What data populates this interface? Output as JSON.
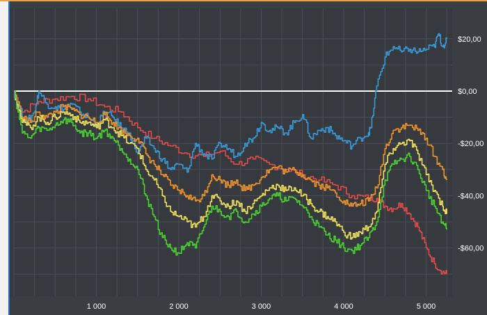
{
  "chart_data": {
    "type": "line",
    "title": "",
    "xlabel": "",
    "ylabel": "",
    "xlim": [
      0,
      5300
    ],
    "ylim": [
      -80,
      28
    ],
    "x_ticks": [
      {
        "value": 1000,
        "label": "1 000"
      },
      {
        "value": 2000,
        "label": "2 000"
      },
      {
        "value": 3000,
        "label": "3 000"
      },
      {
        "value": 4000,
        "label": "4 000"
      },
      {
        "value": 5000,
        "label": "5 000"
      }
    ],
    "y_ticks": [
      {
        "value": 20,
        "label": "$20,00"
      },
      {
        "value": 0,
        "label": "$0,00"
      },
      {
        "value": -20,
        "label": "-$20,00"
      },
      {
        "value": -40,
        "label": "-$40,00"
      },
      {
        "value": -60,
        "label": "-$60,00"
      }
    ],
    "grid": true,
    "zero_line": {
      "value": 0,
      "color": "#ffffff"
    },
    "series": [
      {
        "color": "#e24c4c",
        "x": [
          0,
          100,
          300,
          500,
          700,
          900,
          1100,
          1300,
          1500,
          1700,
          1900,
          2100,
          2300,
          2500,
          2700,
          2900,
          3100,
          3300,
          3500,
          3700,
          3900,
          4100,
          4300,
          4400,
          4500,
          4600,
          4700,
          4800,
          4900,
          5000,
          5100,
          5200,
          5250
        ],
        "values": [
          0,
          -8,
          -4,
          -3,
          -2,
          -3,
          -6,
          -8,
          -14,
          -18,
          -21,
          -24,
          -25,
          -23,
          -28,
          -26,
          -28,
          -30,
          -32,
          -34,
          -36,
          -40,
          -41,
          -41,
          -44,
          -45,
          -43,
          -47,
          -52,
          -60,
          -66,
          -69,
          -70
        ]
      },
      {
        "color": "#3a9ad9",
        "x": [
          0,
          50,
          150,
          250,
          300,
          400,
          500,
          600,
          700,
          800,
          900,
          1000,
          1100,
          1200,
          1300,
          1400,
          1500,
          1600,
          1700,
          1800,
          1900,
          2000,
          2100,
          2200,
          2300,
          2400,
          2500,
          2600,
          2700,
          2800,
          2900,
          3000,
          3100,
          3200,
          3300,
          3400,
          3500,
          3600,
          3700,
          3800,
          3900,
          4000,
          4100,
          4200,
          4300,
          4330,
          4400,
          4500,
          4600,
          4700,
          4800,
          4900,
          5000,
          5100,
          5150,
          5200,
          5250
        ],
        "values": [
          0,
          -6,
          -12,
          -8,
          0,
          -5,
          -6,
          -7,
          -5,
          -8,
          -10,
          -13,
          -8,
          -10,
          -14,
          -16,
          -24,
          -18,
          -22,
          -26,
          -30,
          -28,
          -31,
          -20,
          -24,
          -26,
          -20,
          -22,
          -25,
          -20,
          -18,
          -12,
          -15,
          -14,
          -16,
          -12,
          -9,
          -18,
          -15,
          -14,
          -17,
          -19,
          -21,
          -18,
          -16,
          -14,
          2,
          13,
          17,
          15,
          16,
          15,
          16,
          17,
          22,
          17,
          20
        ]
      },
      {
        "color": "#f0952e",
        "x": [
          0,
          100,
          200,
          300,
          400,
          500,
          600,
          700,
          800,
          900,
          1000,
          1100,
          1200,
          1300,
          1400,
          1500,
          1600,
          1700,
          1800,
          1900,
          2000,
          2100,
          2200,
          2300,
          2400,
          2500,
          2600,
          2700,
          2800,
          2900,
          3000,
          3100,
          3200,
          3300,
          3400,
          3500,
          3600,
          3700,
          3800,
          3900,
          4000,
          4100,
          4200,
          4300,
          4400,
          4500,
          4600,
          4700,
          4800,
          4900,
          5000,
          5100,
          5200,
          5250
        ],
        "values": [
          0,
          -10,
          -12,
          -8,
          -10,
          -8,
          -6,
          -7,
          -9,
          -10,
          -12,
          -9,
          -12,
          -15,
          -17,
          -18,
          -24,
          -28,
          -32,
          -36,
          -38,
          -40,
          -42,
          -40,
          -32,
          -34,
          -36,
          -34,
          -38,
          -36,
          -33,
          -30,
          -29,
          -31,
          -30,
          -32,
          -34,
          -36,
          -37,
          -39,
          -42,
          -44,
          -43,
          -42,
          -37,
          -22,
          -15,
          -14,
          -13,
          -15,
          -18,
          -25,
          -30,
          -34
        ]
      },
      {
        "color": "#f1e35e",
        "x": [
          0,
          100,
          200,
          300,
          400,
          500,
          600,
          700,
          800,
          900,
          1000,
          1100,
          1200,
          1300,
          1400,
          1500,
          1600,
          1700,
          1800,
          1900,
          2000,
          2100,
          2200,
          2300,
          2400,
          2500,
          2600,
          2700,
          2800,
          2900,
          3000,
          3100,
          3200,
          3300,
          3400,
          3500,
          3600,
          3700,
          3800,
          3900,
          4000,
          4100,
          4200,
          4300,
          4400,
          4500,
          4600,
          4700,
          4800,
          4900,
          5000,
          5100,
          5200,
          5250
        ],
        "values": [
          0,
          -12,
          -14,
          -10,
          -12,
          -10,
          -8,
          -9,
          -12,
          -12,
          -14,
          -11,
          -14,
          -17,
          -20,
          -22,
          -30,
          -34,
          -40,
          -46,
          -48,
          -50,
          -52,
          -48,
          -40,
          -42,
          -44,
          -42,
          -46,
          -43,
          -40,
          -37,
          -36,
          -38,
          -37,
          -40,
          -43,
          -46,
          -48,
          -50,
          -54,
          -56,
          -54,
          -52,
          -46,
          -28,
          -22,
          -20,
          -19,
          -24,
          -32,
          -38,
          -44,
          -47
        ]
      },
      {
        "color": "#4bd332",
        "x": [
          0,
          100,
          200,
          300,
          400,
          500,
          600,
          700,
          800,
          900,
          1000,
          1100,
          1200,
          1300,
          1400,
          1500,
          1600,
          1700,
          1800,
          1900,
          2000,
          2100,
          2200,
          2300,
          2400,
          2500,
          2600,
          2700,
          2800,
          2900,
          3000,
          3100,
          3200,
          3300,
          3400,
          3500,
          3600,
          3700,
          3800,
          3900,
          4000,
          4100,
          4200,
          4300,
          4400,
          4500,
          4600,
          4700,
          4800,
          4900,
          5000,
          5100,
          5200,
          5250
        ],
        "values": [
          0,
          -16,
          -18,
          -14,
          -15,
          -13,
          -11,
          -12,
          -16,
          -16,
          -18,
          -15,
          -18,
          -22,
          -26,
          -30,
          -40,
          -48,
          -56,
          -60,
          -62,
          -58,
          -60,
          -52,
          -44,
          -46,
          -48,
          -46,
          -50,
          -47,
          -44,
          -41,
          -40,
          -42,
          -41,
          -44,
          -48,
          -52,
          -55,
          -57,
          -60,
          -61,
          -59,
          -56,
          -50,
          -34,
          -28,
          -26,
          -25,
          -30,
          -38,
          -44,
          -50,
          -53
        ]
      }
    ]
  }
}
